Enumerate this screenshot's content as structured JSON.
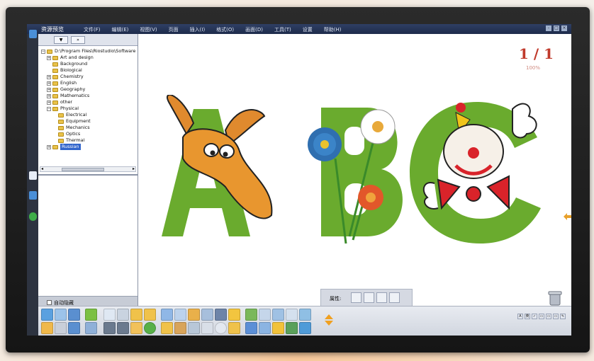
{
  "window": {
    "title": "资源预览",
    "menu": [
      "文件(F)",
      "编辑(E)",
      "视图(V)",
      "页面",
      "插入(I)",
      "格式(O)",
      "画面(D)",
      "工具(T)",
      "设置",
      "帮助(H)"
    ],
    "controls": [
      "-",
      "□",
      "×"
    ]
  },
  "resource_panel": {
    "toolbar_buttons": [
      "▼",
      "»"
    ],
    "root_path": "D:\\Program Files\\Riostudio\\Software",
    "tree": [
      {
        "label": "Art and design",
        "expander": "+"
      },
      {
        "label": "Background",
        "expander": ""
      },
      {
        "label": "Biological",
        "expander": ""
      },
      {
        "label": "Chemistry",
        "expander": "+"
      },
      {
        "label": "English",
        "expander": "+"
      },
      {
        "label": "Geography",
        "expander": "+"
      },
      {
        "label": "Mathematics",
        "expander": "+"
      },
      {
        "label": "other",
        "expander": "+"
      },
      {
        "label": "Physical",
        "expander": "−"
      },
      {
        "label": "Electrical",
        "expander": ""
      },
      {
        "label": "Equipment",
        "expander": ""
      },
      {
        "label": "Mechanics",
        "expander": ""
      },
      {
        "label": "Optics",
        "expander": ""
      },
      {
        "label": "Thermal",
        "expander": ""
      },
      {
        "label": "Russian",
        "expander": "+",
        "selected": true
      }
    ],
    "auto_hide_label": "自动隐藏"
  },
  "canvas": {
    "page_indicator": "1 / 1",
    "zoom_level": "100%",
    "letters": [
      "A",
      "B",
      "C"
    ],
    "letter_color": "#6aab2e"
  },
  "properties_tab": {
    "label": "属性:"
  },
  "colors": {
    "accent_red": "#c0392b",
    "toolbar_green": "#7bc043",
    "menubar": "#1d2b4b"
  },
  "toolbar": {
    "tools_row1": [
      "open-icon",
      "copy-icon",
      "undo-icon",
      "pointer-icon",
      "new-page-icon",
      "page-icon",
      "zoom-in-icon",
      "zoom-out-icon",
      "screen-icon",
      "capture-icon",
      "eraser-icon",
      "print-icon",
      "film-icon",
      "marker-icon",
      "link-icon",
      "window-icon",
      "image-icon",
      "edit-icon",
      "grid-icon"
    ],
    "tools_row2": [
      "save-icon",
      "paste-icon",
      "redo-icon",
      "screen-share-icon",
      "back-icon",
      "forward-icon",
      "hand-icon",
      "play-icon",
      "magnifier-icon",
      "camera-icon",
      "insert-image-icon",
      "table-icon",
      "clock-icon",
      "brush-icon",
      "pen-icon",
      "highlighter-icon",
      "text-icon",
      "person-icon",
      "recorder-icon"
    ],
    "mini_tools": [
      "A",
      "英",
      "✓",
      "▭",
      "▭",
      "▭",
      "✎"
    ]
  }
}
